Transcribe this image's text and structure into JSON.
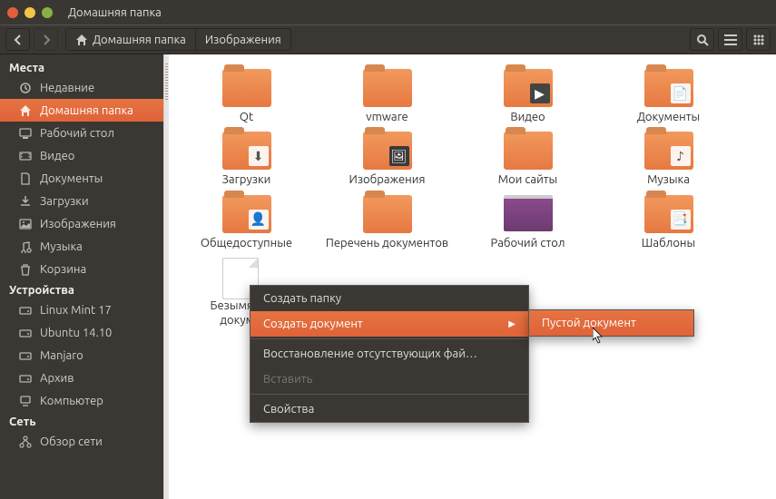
{
  "window": {
    "title": "Домашняя папка"
  },
  "path": {
    "home": "Домашняя папка",
    "child": "Изображения"
  },
  "sidebar": {
    "section_places": "Места",
    "section_devices": "Устройства",
    "section_network": "Сеть",
    "places": [
      {
        "icon": "clock",
        "label": "Недавние"
      },
      {
        "icon": "home",
        "label": "Домашняя папка",
        "active": true
      },
      {
        "icon": "desktop",
        "label": "Рабочий стол"
      },
      {
        "icon": "video",
        "label": "Видео"
      },
      {
        "icon": "doc",
        "label": "Документы"
      },
      {
        "icon": "download",
        "label": "Загрузки"
      },
      {
        "icon": "picture",
        "label": "Изображения"
      },
      {
        "icon": "music",
        "label": "Музыка"
      },
      {
        "icon": "trash",
        "label": "Корзина"
      }
    ],
    "devices": [
      {
        "icon": "drive",
        "label": "Linux Mint 17"
      },
      {
        "icon": "drive",
        "label": "Ubuntu 14.10"
      },
      {
        "icon": "drive",
        "label": "Manjaro"
      },
      {
        "icon": "drive",
        "label": "Архив"
      },
      {
        "icon": "computer",
        "label": "Компьютер"
      }
    ],
    "network": [
      {
        "icon": "network",
        "label": "Обзор сети"
      }
    ]
  },
  "folders": [
    {
      "label": "Qt",
      "icon": "folder"
    },
    {
      "label": "vmware",
      "icon": "folder"
    },
    {
      "label": "Видео",
      "icon": "folder-video"
    },
    {
      "label": "Документы",
      "icon": "folder-doc"
    },
    {
      "label": "Загрузки",
      "icon": "folder-download"
    },
    {
      "label": "Изображения",
      "icon": "folder-picture"
    },
    {
      "label": "Мои сайты",
      "icon": "folder"
    },
    {
      "label": "Музыка",
      "icon": "folder-music"
    },
    {
      "label": "Общедоступные",
      "icon": "folder-public"
    },
    {
      "label": "Перечень документов",
      "icon": "folder"
    },
    {
      "label": "Рабочий стол",
      "icon": "desktop"
    },
    {
      "label": "Шаблоны",
      "icon": "folder-template"
    },
    {
      "label": "Безымянный документ",
      "icon": "file"
    }
  ],
  "menu": {
    "create_folder": "Создать папку",
    "create_document": "Создать документ",
    "restore_missing": "Восстановление отсутствующих фай…",
    "paste": "Вставить",
    "properties": "Свойства",
    "empty_document": "Пустой документ"
  },
  "icons": {
    "back": "‹",
    "forward": "›",
    "home": "⌂",
    "search": "🔍",
    "list": "≡",
    "grid": "⠿"
  }
}
